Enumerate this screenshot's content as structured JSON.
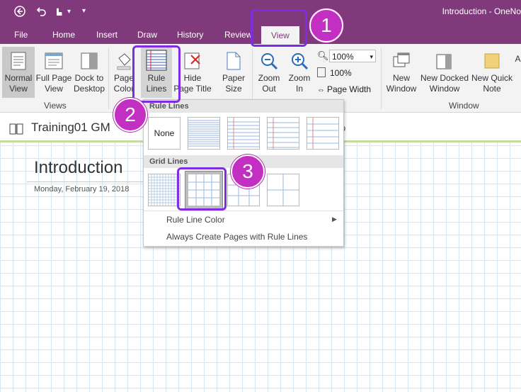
{
  "titlebar": {
    "title": "Introduction  -  OneNo",
    "quick_access": [
      "back",
      "undo",
      "touch",
      "more"
    ]
  },
  "tabs": [
    "File",
    "Home",
    "Insert",
    "Draw",
    "History",
    "Review",
    "View"
  ],
  "ribbon": {
    "views": {
      "normal_view": [
        "Normal",
        "View"
      ],
      "full_page_view": [
        "Full Page",
        "View"
      ],
      "dock_to_desktop": [
        "Dock to",
        "Desktop"
      ],
      "group_label": "Views"
    },
    "page_color": [
      "Page",
      "Color"
    ],
    "rule_lines": [
      "Rule",
      "Lines"
    ],
    "hide_page_title": [
      "Hide",
      "Page Title"
    ],
    "paper_size": [
      "Paper",
      "Size"
    ],
    "zoom_out": [
      "Zoom",
      "Out"
    ],
    "zoom_in": [
      "Zoom",
      "In"
    ],
    "zoom_value": "100%",
    "zoom_100": "100%",
    "page_width": "Page Width",
    "window": {
      "new_window": [
        "New",
        "Window"
      ],
      "new_docked_window": [
        "New Docked",
        "Window"
      ],
      "new_quick_note": [
        "New Quick",
        "Note"
      ],
      "group_label": "Window"
    }
  },
  "notebook": {
    "name": "Training01 GM",
    "tail": "p"
  },
  "page": {
    "title": "Introduction",
    "date": "Monday, February 19, 2018"
  },
  "dropdown": {
    "rule_lines_header": "Rule Lines",
    "none_label": "None",
    "grid_lines_header": "Grid Lines",
    "rule_line_color": "Rule Line Color",
    "always_create": "Always Create Pages with Rule Lines"
  },
  "callouts": [
    "1",
    "2",
    "3"
  ],
  "colors": {
    "accent": "#80397b",
    "callout": "#c22fc2",
    "highlight": "#7e2ee0",
    "grid": "#d6e7f2"
  }
}
